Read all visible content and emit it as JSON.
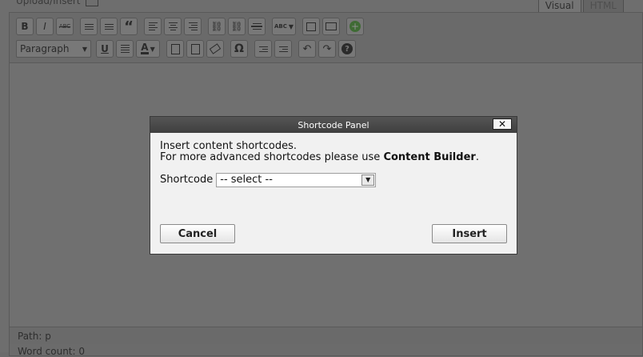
{
  "top": {
    "upload_label": "Upload/Insert",
    "tabs": [
      {
        "label": "Visual",
        "active": true
      },
      {
        "label": "HTML",
        "active": false
      }
    ]
  },
  "toolbar": {
    "row1": {
      "bold": "B",
      "italic": "I",
      "strikethrough": "ABC",
      "blockquote": "“",
      "spellcheck": "ABC",
      "add": "+"
    },
    "row2": {
      "format_value": "Paragraph",
      "underline": "U",
      "text_color": "A",
      "omega": "Ω",
      "help": "?"
    }
  },
  "status": {
    "path_label": "Path:",
    "path_value": "p",
    "word_count": "Word count: 0"
  },
  "modal": {
    "title": "Shortcode Panel",
    "close_label": "✕",
    "line1": "Insert content shortcodes.",
    "line2_prefix": "For more advanced shortcodes please use ",
    "line2_bold": "Content Builder",
    "line2_suffix": ".",
    "shortcode_label": "Shortcode",
    "shortcode_selected": "-- select --",
    "cancel_label": "Cancel",
    "insert_label": "Insert"
  }
}
